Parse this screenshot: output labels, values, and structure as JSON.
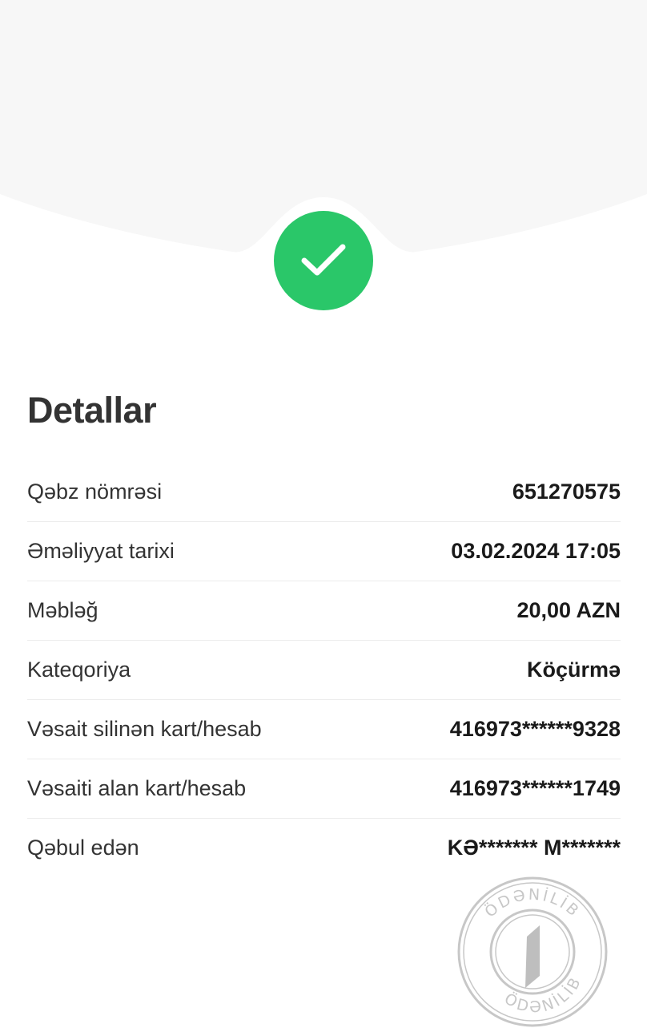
{
  "header": {
    "status_icon": "checkmark-icon",
    "accent_color": "#2ac769",
    "background_color": "#f7f7f7"
  },
  "details": {
    "title": "Detallar",
    "rows": [
      {
        "label": "Qəbz nömrəsi",
        "value": "651270575"
      },
      {
        "label": "Əməliyyat tarixi",
        "value": "03.02.2024 17:05"
      },
      {
        "label": "Məbləğ",
        "value": "20,00 AZN"
      },
      {
        "label": "Kateqoriya",
        "value": "Köçürmə"
      },
      {
        "label": "Vəsait silinən kart/hesab",
        "value": "416973******9328"
      },
      {
        "label": "Vəsaiti alan kart/hesab",
        "value": "416973******1749"
      },
      {
        "label": "Qəbul edən",
        "value": "KƏ******* M*******"
      }
    ]
  },
  "stamp": {
    "text": "ÖDƏNİLİB"
  }
}
